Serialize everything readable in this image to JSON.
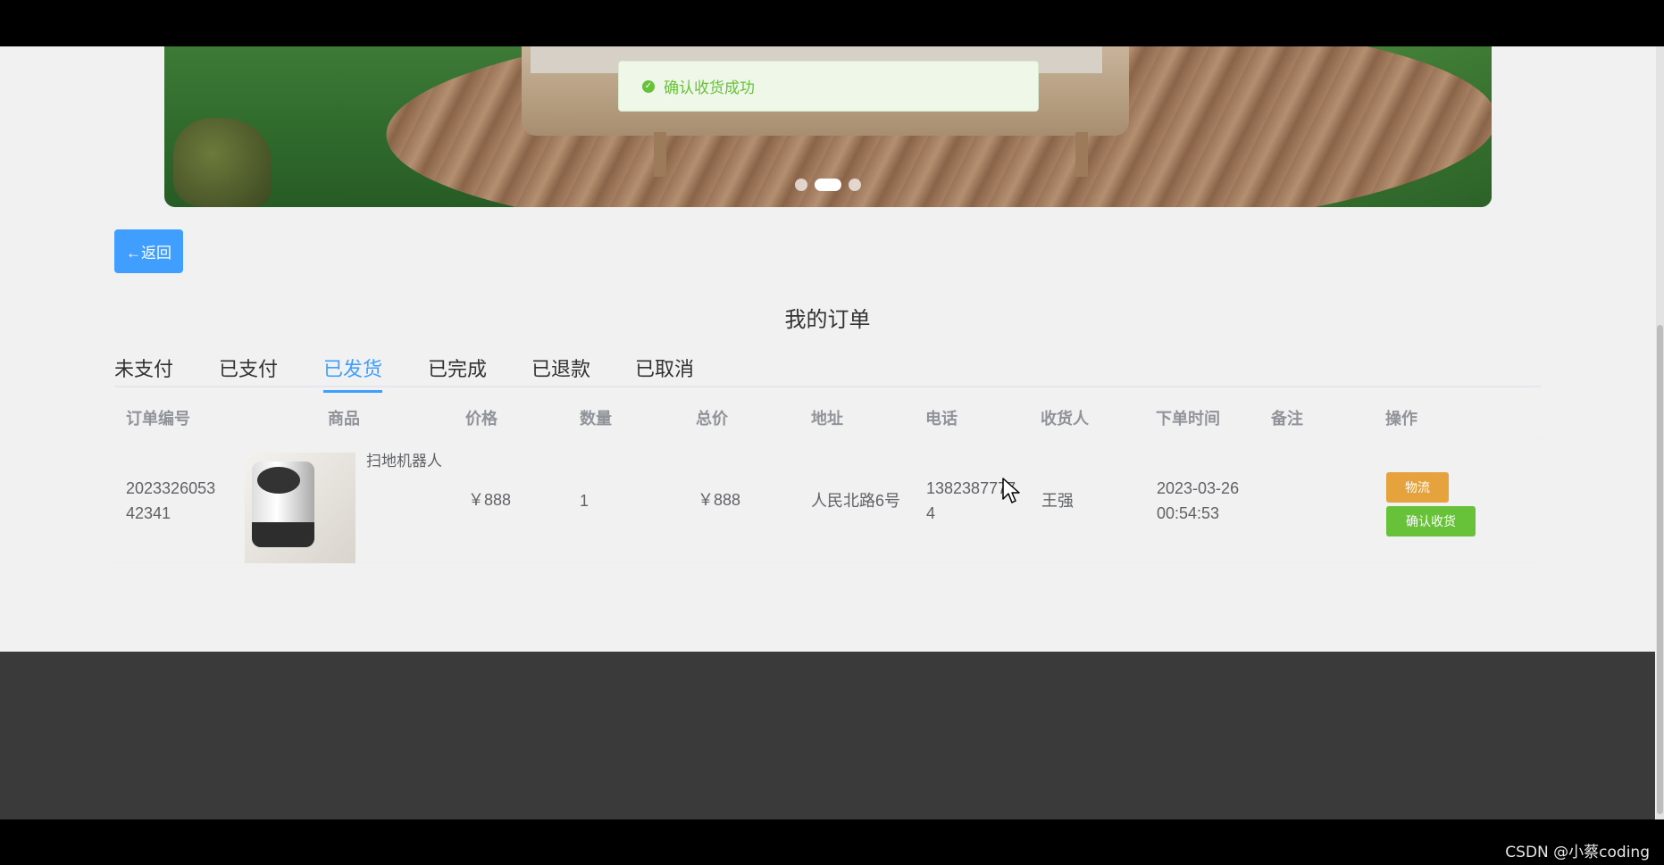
{
  "toast": {
    "message": "确认收货成功",
    "icon": "check-circle-icon"
  },
  "banner": {
    "dots": 3,
    "active_dot": 2
  },
  "back_button": {
    "label": "←返回"
  },
  "page_title": "我的订单",
  "tabs": [
    {
      "label": "未支付",
      "active": false
    },
    {
      "label": "已支付",
      "active": false
    },
    {
      "label": "已发货",
      "active": true
    },
    {
      "label": "已完成",
      "active": false
    },
    {
      "label": "已退款",
      "active": false
    },
    {
      "label": "已取消",
      "active": false
    }
  ],
  "table": {
    "headers": [
      "订单编号",
      "商品",
      "价格",
      "数量",
      "总价",
      "地址",
      "电话",
      "收货人",
      "下单时间",
      "备注",
      "操作"
    ],
    "rows": [
      {
        "order_no_line1": "2023326053",
        "order_no_line2": "42341",
        "product_name": "扫地机器人",
        "price": "￥888",
        "quantity": "1",
        "total": "￥888",
        "address": "人民北路6号",
        "phone_line1": "1382387777",
        "phone_line2": "4",
        "receiver": "王强",
        "date": "2023-03-26",
        "time": "00:54:53",
        "note": "",
        "actions": {
          "logistics": "物流",
          "confirm": "确认收货"
        }
      }
    ]
  },
  "watermark": "CSDN @小蔡coding",
  "colors": {
    "primary": "#409eff",
    "success": "#67c23a",
    "warning": "#e6a23c",
    "footer": "#3a3a3a"
  }
}
